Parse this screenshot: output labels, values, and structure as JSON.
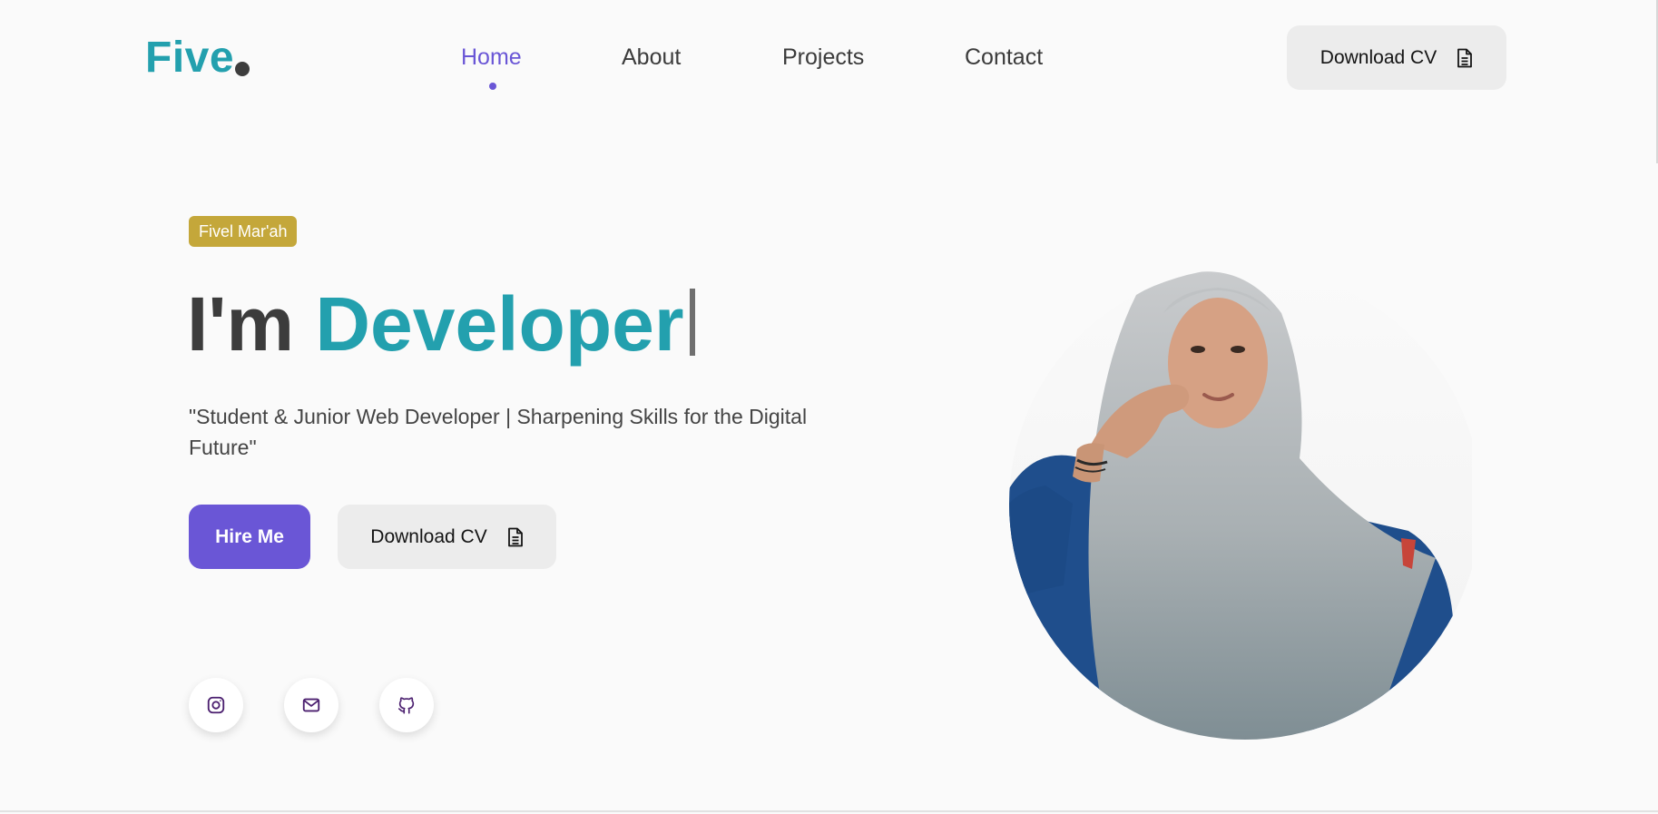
{
  "header": {
    "logo_text": "Five",
    "nav": [
      {
        "label": "Home",
        "active": true
      },
      {
        "label": "About",
        "active": false
      },
      {
        "label": "Projects",
        "active": false
      },
      {
        "label": "Contact",
        "active": false
      }
    ],
    "download_cv_label": "Download CV"
  },
  "hero": {
    "badge": "Fivel Mar'ah",
    "headline_prefix": "I'm",
    "headline_accent": "Developer",
    "tagline": "\"Student & Junior Web Developer | Sharpening Skills for the Digital Future\"",
    "hire_label": "Hire Me",
    "download_cv_label": "Download CV"
  },
  "social": [
    {
      "icon": "instagram-icon"
    },
    {
      "icon": "mail-icon"
    },
    {
      "icon": "github-icon"
    }
  ],
  "colors": {
    "brand_teal": "#23a0ae",
    "accent_purple": "#6a56d6",
    "badge_gold": "#c4a73a",
    "background": "#fafafa"
  }
}
